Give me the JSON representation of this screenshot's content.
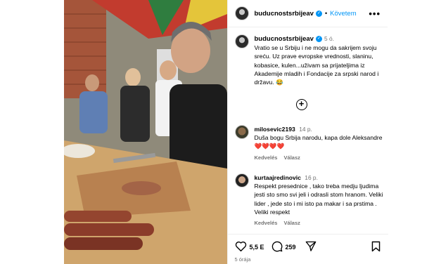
{
  "post": {
    "username": "buducnostsrbijeav",
    "follow_label": "Követem",
    "more_label": "•••",
    "caption": "Vratio se u Srbiju i ne mogu da sakrijem svoju sreću. Uz prave evropske vrednosti, slaninu, kobasice, kulen...uživam sa prijateljima iz Akademije mladih i Fondacije za srpski narod i državu. 😂",
    "caption_time": "5 ó.",
    "likes": "5,5 E",
    "comments": "259",
    "posted_ago": "5 órája"
  },
  "comments": [
    {
      "user": "milosevic2193",
      "time": "14 p.",
      "text": "Duša bogu Srbija narodu, kapa dole Aleksandre❤️❤️❤️❤️",
      "like_label": "Kedvelés",
      "reply_label": "Válasz"
    },
    {
      "user": "kurtaajredinovic",
      "time": "16 p.",
      "text": "Respekt presednice , tako treba medju ljudima jesti sto smo svi jeli i odrasli stom hranom. Veliki lider , jede sto i mi isto pa makar i sa prstima . Veliki respekt",
      "like_label": "Kedvelés",
      "reply_label": "Válasz"
    }
  ],
  "icons": {
    "verified": "✓",
    "plus": "+"
  },
  "colors": {
    "accent": "#0095f6",
    "muted": "#737373"
  }
}
